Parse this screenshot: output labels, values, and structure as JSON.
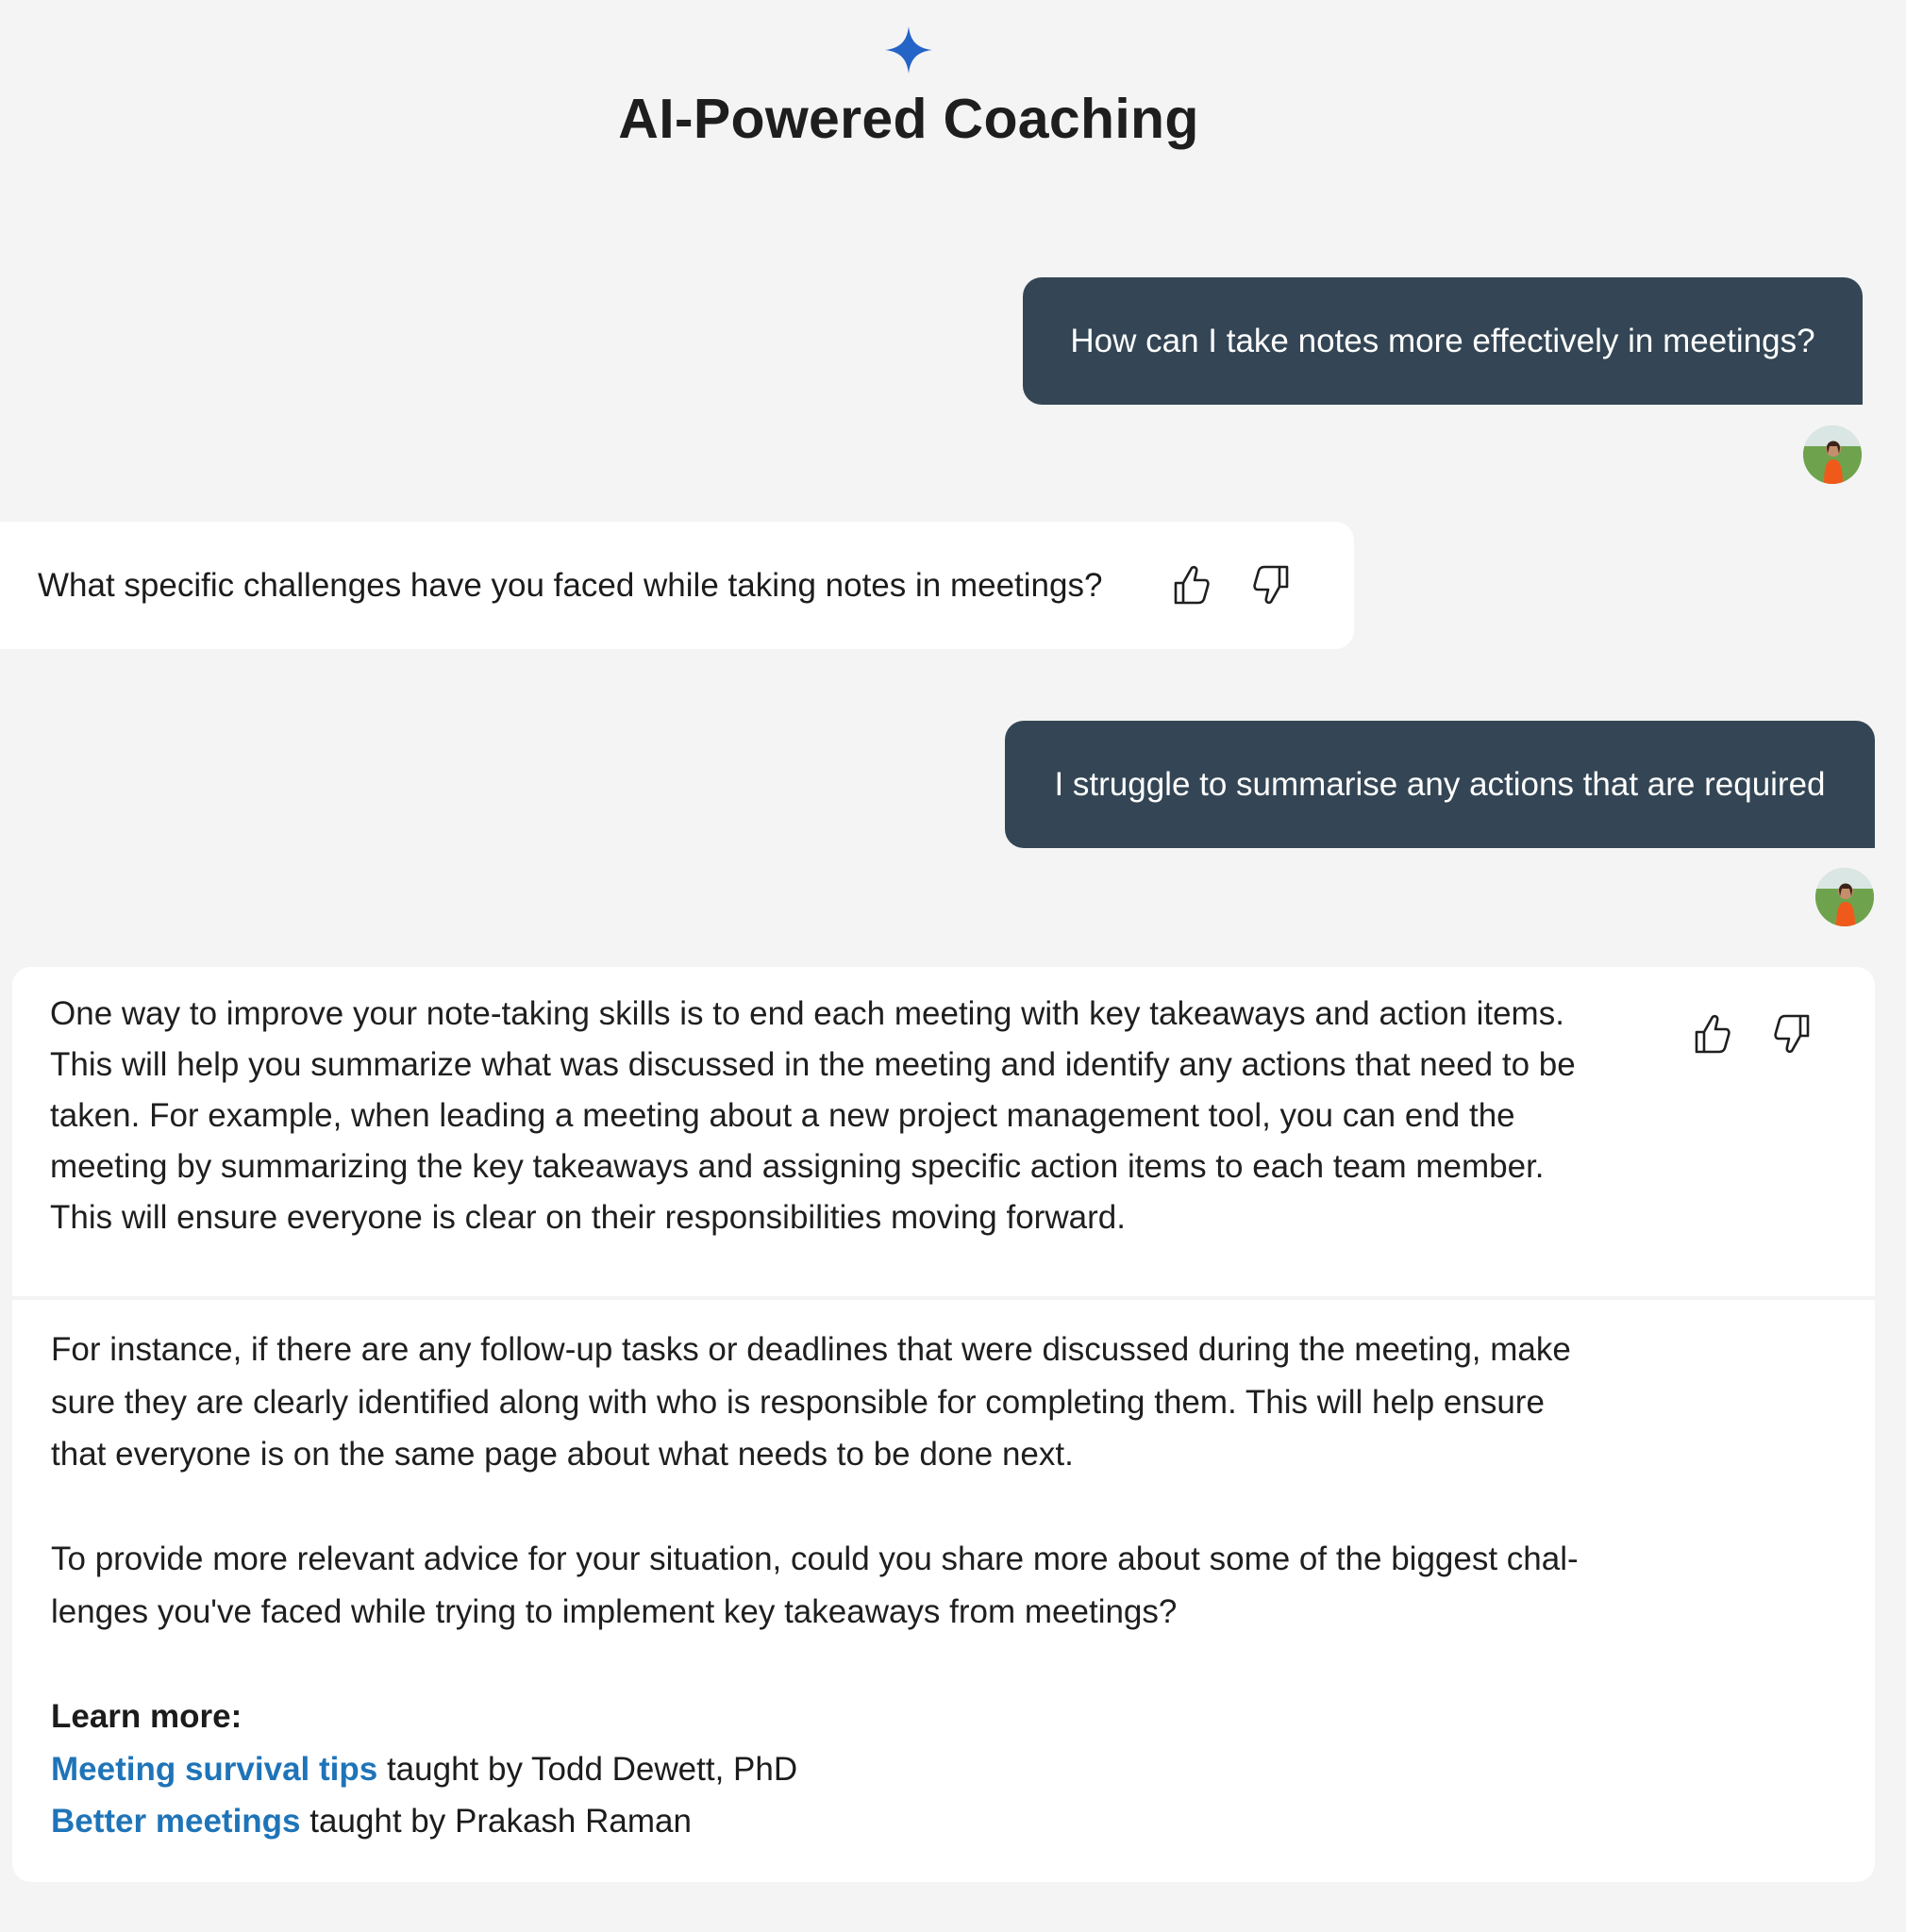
{
  "header": {
    "title": "AI-Powered Coaching",
    "icon": "sparkle-icon",
    "accent_color": "#2564c7"
  },
  "conversation": {
    "user_bubble_color": "#344655",
    "messages": [
      {
        "role": "user",
        "text": "How can I take notes more effectively in meetings?"
      },
      {
        "role": "assistant",
        "text": "What specific challenges have you faced while taking notes in meetings?"
      },
      {
        "role": "user",
        "text": "I struggle to summarise any actions that are required"
      },
      {
        "role": "assistant",
        "paragraph1": [
          "One way to improve your note-taking skills is to end each meeting with key takeaways and action items.",
          "This will help you summarize what was discussed in the meeting and identify any actions that need to be",
          "taken. For example, when leading a meeting about a new project management tool, you can end the",
          "meeting by summarizing the key takeaways and assigning specific action items to each team member.",
          "This will ensure everyone is clear on their responsibilities moving forward."
        ],
        "paragraph2": [
          "For instance, if there are any follow-up tasks or deadlines that were discussed during the meeting, make",
          "sure they are clearly identified along with who is responsible for completing them. This will help ensure",
          "that everyone is on the same page about what needs to be done next."
        ],
        "paragraph3": [
          "To provide more relevant advice for your situation, could you share more about some of the biggest chal-",
          "lenges you've faced while trying to implement key takeaways from meetings?"
        ],
        "learn_more": {
          "title": "Learn more:",
          "links": [
            {
              "link_text": "Meeting survival tips",
              "suffix": " taught by Todd Dewett, PhD"
            },
            {
              "link_text": "Better meetings",
              "suffix": " taught by Prakash Raman"
            }
          ]
        }
      }
    ]
  },
  "feedback": {
    "like_icon": "thumbs-up-icon",
    "dislike_icon": "thumbs-down-icon"
  }
}
